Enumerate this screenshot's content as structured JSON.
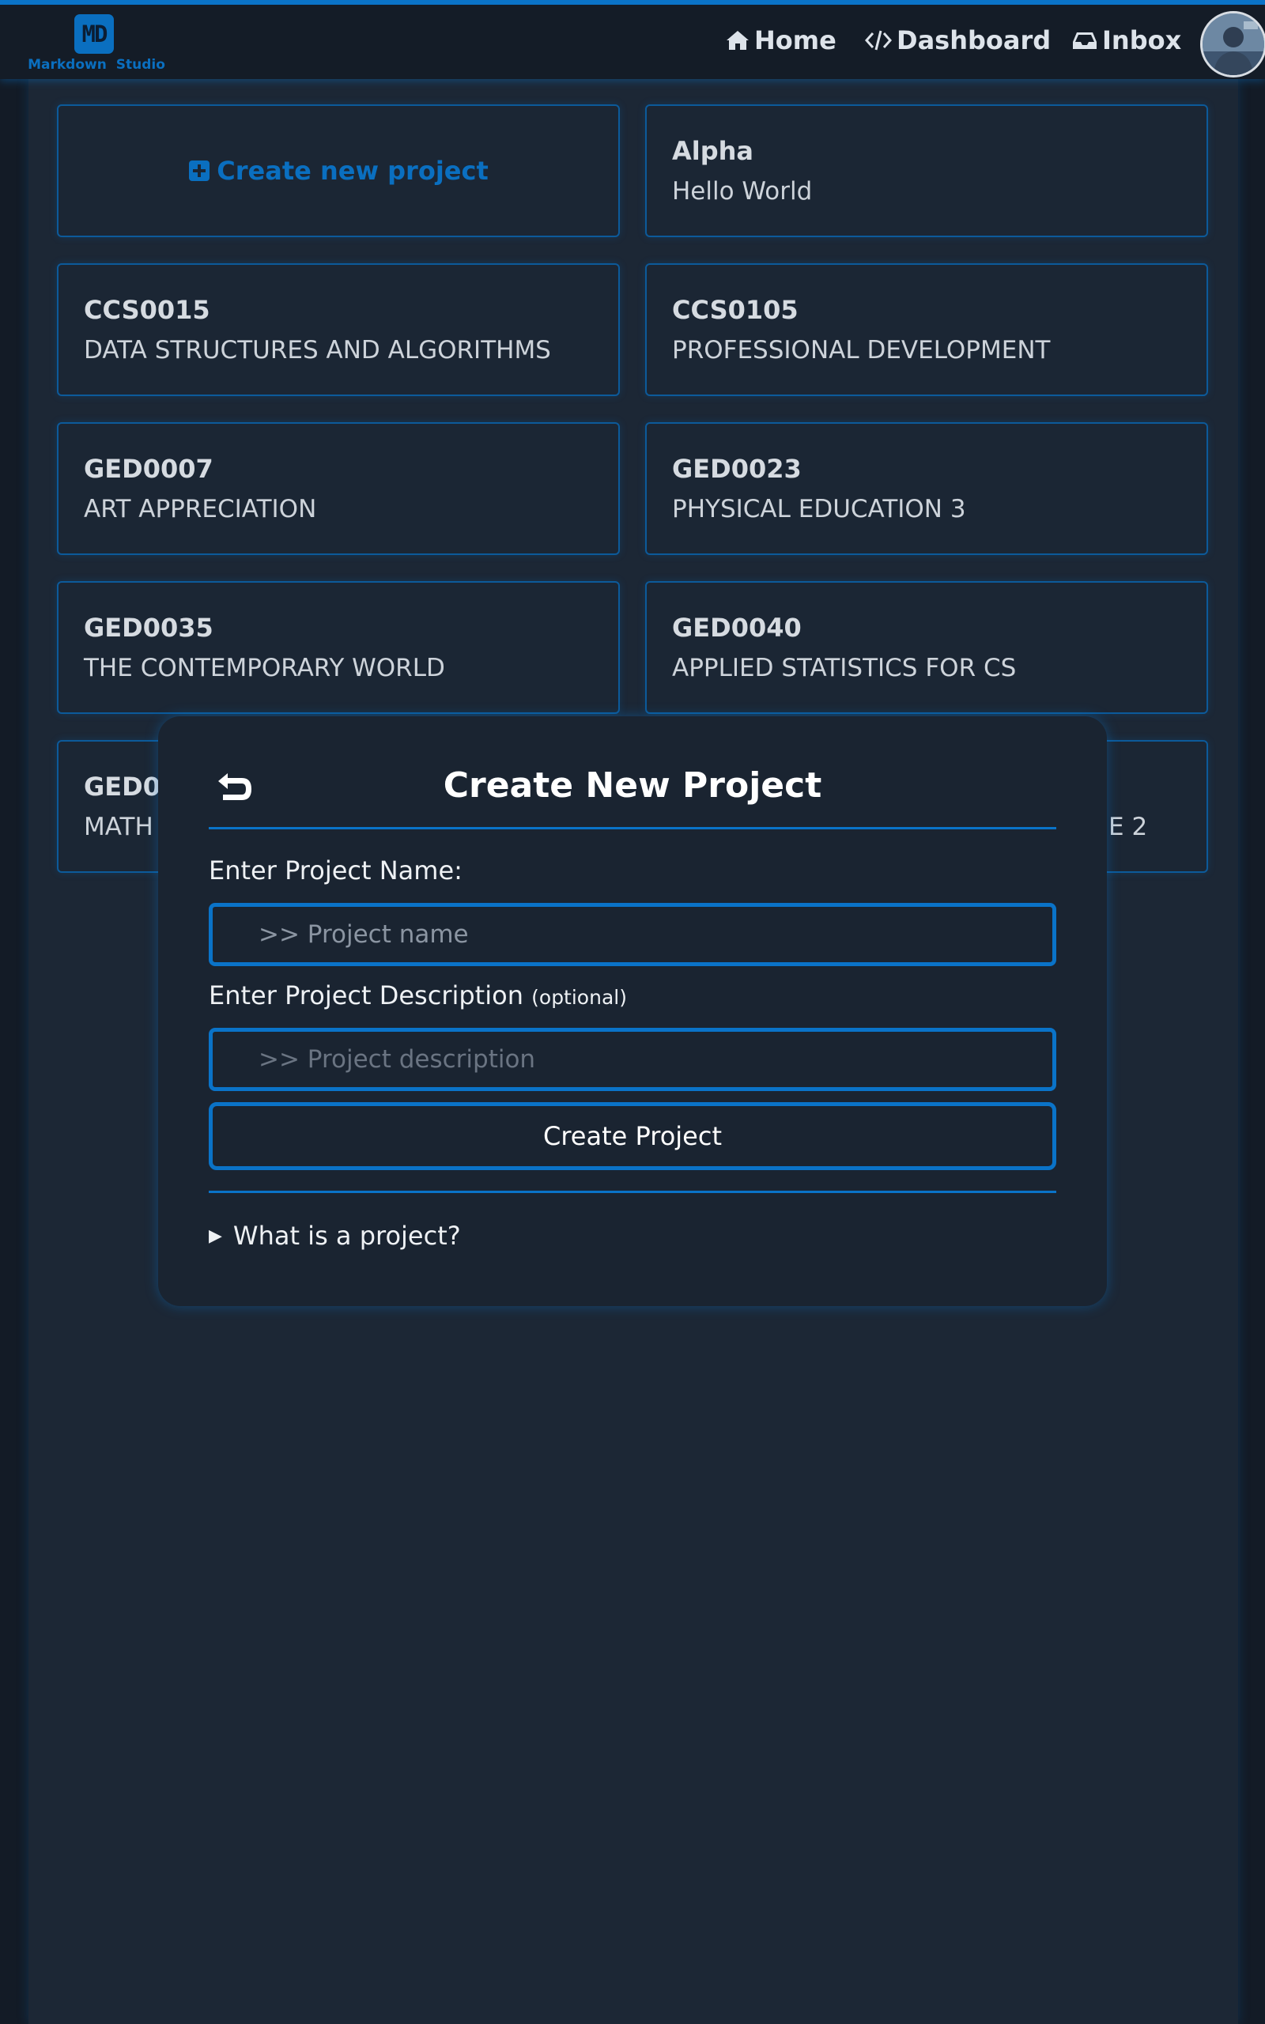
{
  "app": {
    "logo_text": "MD",
    "name": "Markdown Studio"
  },
  "nav": {
    "home": "Home",
    "dashboard": "Dashboard",
    "inbox": "Inbox"
  },
  "create_card": {
    "label": "Create new project"
  },
  "projects": [
    {
      "code": "Alpha",
      "name": "Hello World"
    },
    {
      "code": "CCS0015",
      "name": "DATA STRUCTURES AND ALGORITHMS"
    },
    {
      "code": "CCS0105",
      "name": "PROFESSIONAL DEVELOPMENT"
    },
    {
      "code": "GED0007",
      "name": "ART APPRECIATION"
    },
    {
      "code": "GED0023",
      "name": "PHYSICAL EDUCATION 3"
    },
    {
      "code": "GED0035",
      "name": "THE CONTEMPORARY WORLD"
    },
    {
      "code": "GED0040",
      "name": "APPLIED STATISTICS FOR CS"
    },
    {
      "code": "GED0",
      "name": "MATH"
    },
    {
      "code": "",
      "name": "E 2"
    }
  ],
  "modal": {
    "title": "Create New Project",
    "name_label": "Enter Project Name:",
    "name_placeholder": ">> Project name",
    "desc_label": "Enter Project Description",
    "desc_optional": "(optional)",
    "desc_placeholder": ">> Project description",
    "submit_label": "Create Project",
    "details_summary": "What is a project?"
  },
  "colors": {
    "accent": "#0a73c8",
    "background": "#1c2735",
    "topbar": "#141c27"
  },
  "icons": [
    "home-icon",
    "code-icon",
    "inbox-icon",
    "plus-square-icon",
    "back-arrow-icon",
    "avatar"
  ]
}
